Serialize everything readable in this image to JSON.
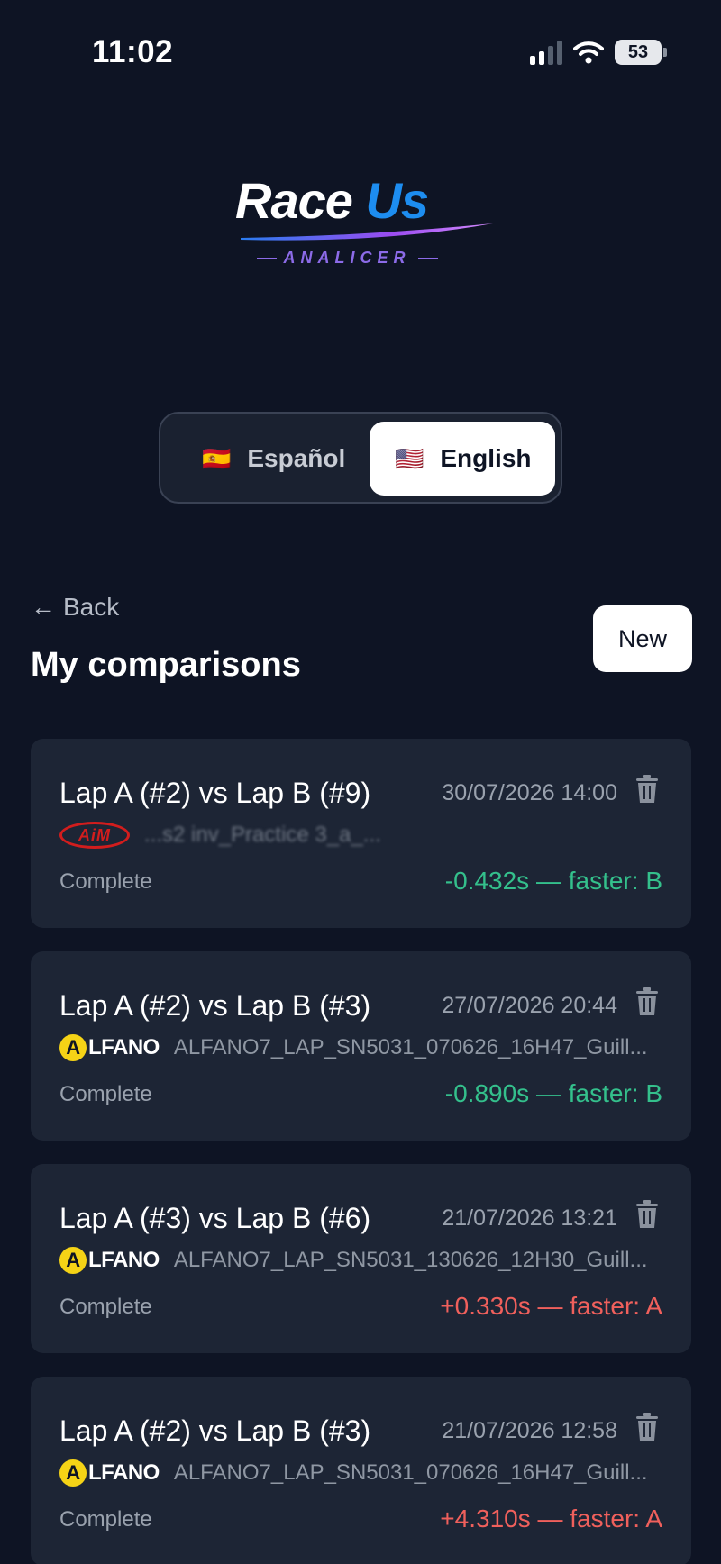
{
  "status_bar": {
    "time": "11:02",
    "battery": "53"
  },
  "logo": {
    "word1": "Race",
    "word2": "Us",
    "subtitle": "ANALICER"
  },
  "languages": [
    {
      "flag": "🇪🇸",
      "label": "Español",
      "selected": false
    },
    {
      "flag": "🇺🇸",
      "label": "English",
      "selected": true
    }
  ],
  "header": {
    "back_label": "Back",
    "title": "My comparisons",
    "new_label": "New"
  },
  "comparisons": [
    {
      "title": "Lap A (#2) vs Lap B (#9)",
      "date": "30/07/2026 14:00",
      "brand": "AiM",
      "file": "...s2 inv_Practice 3_a_...",
      "status": "Complete",
      "result": "-0.432s — faster: B",
      "result_color": "#34c08c"
    },
    {
      "title": "Lap A (#2) vs Lap B (#3)",
      "date": "27/07/2026 20:44",
      "brand": "ALFANO",
      "file": "ALFANO7_LAP_SN5031_070626_16H47_Guill...",
      "status": "Complete",
      "result": "-0.890s — faster: B",
      "result_color": "#34c08c"
    },
    {
      "title": "Lap A (#3) vs Lap B (#6)",
      "date": "21/07/2026 13:21",
      "brand": "ALFANO",
      "file": "ALFANO7_LAP_SN5031_130626_12H30_Guill...",
      "status": "Complete",
      "result": "+0.330s — faster: A",
      "result_color": "#f0605c"
    },
    {
      "title": "Lap A (#2) vs Lap B (#3)",
      "date": "21/07/2026 12:58",
      "brand": "ALFANO",
      "file": "ALFANO7_LAP_SN5031_070626_16H47_Guill...",
      "status": "Complete",
      "result": "+4.310s — faster: A",
      "result_color": "#f0605c"
    }
  ]
}
